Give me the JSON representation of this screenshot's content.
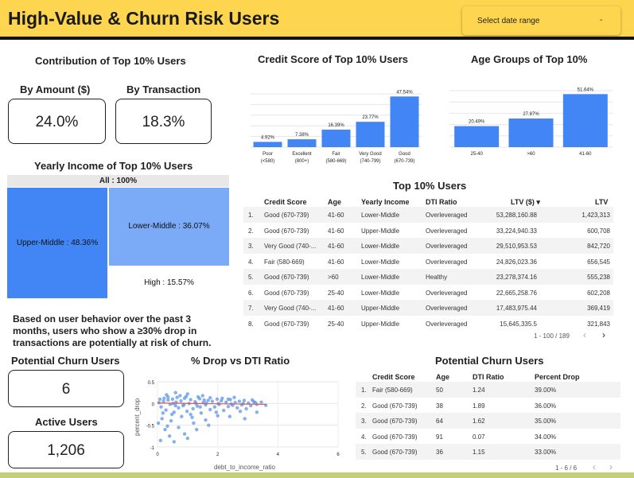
{
  "header": {
    "title": "High-Value & Churn Risk Users",
    "date_range_label": "Select date range",
    "caret": "-"
  },
  "contribution": {
    "title": "Contribution of Top 10% Users",
    "by_amount_label": "By Amount ($)",
    "by_amount_value": "24.0%",
    "by_transaction_label": "By Transaction",
    "by_transaction_value": "18.3%"
  },
  "churn_note": {
    "line1": "Based on user behavior over the past 3",
    "line2": "months, users who show a ≥30% drop in",
    "line3": "transactions are potentially at risk of churn."
  },
  "kpis": {
    "potential_label": "Potential Churn Users",
    "potential_value": "6",
    "active_label": "Active Users",
    "active_value": "1,206"
  },
  "top_users": {
    "title": "Top 10% Users",
    "columns": [
      "Credit Score",
      "Age",
      "Yearly Income",
      "DTI Ratio",
      "LTV ($) ▾",
      "LTV"
    ],
    "rows": [
      [
        "1.",
        "Good (670-739)",
        "41-60",
        "Lower-Middle",
        "Overleveraged",
        "53,288,160.88",
        "1,423,313"
      ],
      [
        "2.",
        "Good (670-739)",
        "41-60",
        "Upper-Middle",
        "Overleveraged",
        "33,224,940.33",
        "600,708"
      ],
      [
        "3.",
        "Very Good (740-...",
        "41-60",
        "Lower-Middle",
        "Overleveraged",
        "29,510,953.53",
        "842,720"
      ],
      [
        "4.",
        "Fair (580-669)",
        "41-60",
        "Lower-Middle",
        "Overleveraged",
        "24,826,023.36",
        "656,545"
      ],
      [
        "5.",
        "Good (670-739)",
        ">60",
        "Lower-Middle",
        "Healthy",
        "23,278,374.16",
        "555,238"
      ],
      [
        "6.",
        "Good (670-739)",
        "25-40",
        "Lower-Middle",
        "Overleveraged",
        "22,665,258.76",
        "602,208"
      ],
      [
        "7.",
        "Very Good (740-...",
        "41-60",
        "Upper-Middle",
        "Overleveraged",
        "17,483,975.44",
        "369,419"
      ],
      [
        "8.",
        "Good (670-739)",
        "25-40",
        "Upper-Middle",
        "Overleveraged",
        "15,645,335.5",
        "321,843"
      ]
    ],
    "pagination": "1 - 100 / 189"
  },
  "churn_table": {
    "title": "Potential Churn Users",
    "columns": [
      "Credit Score",
      "Age",
      "DTI Ratio",
      "Percent Drop"
    ],
    "rows": [
      [
        "1.",
        "Fair (580-669)",
        "50",
        "1.24",
        "39.00%"
      ],
      [
        "2.",
        "Good (670-739)",
        "38",
        "1.89",
        "36.00%"
      ],
      [
        "3.",
        "Good (670-739)",
        "64",
        "1.62",
        "35.00%"
      ],
      [
        "4.",
        "Good (670-739)",
        "91",
        "0.07",
        "34.00%"
      ],
      [
        "5.",
        "Good (670-739)",
        "36",
        "1.15",
        "33.00%"
      ]
    ],
    "pagination": "1 - 6 / 6"
  },
  "colors": {
    "header": "#fdd54f",
    "bar": "#4285f4",
    "treemap_dark": "#4285f4",
    "treemap_light": "#7baaf7",
    "scatter": "#5b95e6",
    "trend": "#e8594b"
  },
  "chart_data": [
    {
      "type": "bar",
      "title": "Credit Score of Top 10% Users",
      "categories": [
        "Poor\n(<580)",
        "Excellent\n(800+)",
        "Fair\n(580-669)",
        "Very Good\n(740-799)",
        "Good\n(670-739)"
      ],
      "values": [
        4.92,
        7.38,
        16.39,
        23.77,
        47.54
      ],
      "data_labels": [
        "4.92%",
        "7.38%",
        "16.39%",
        "23.77%",
        "47.54%"
      ],
      "ylim": [
        0,
        50
      ],
      "grid": true
    },
    {
      "type": "bar",
      "title": "Age Groups of Top 10%",
      "categories": [
        "25-40",
        ">60",
        "41-60"
      ],
      "values": [
        20.49,
        27.87,
        51.64
      ],
      "data_labels": [
        "20.49%",
        "27.87%",
        "51.64%"
      ],
      "ylim": [
        0,
        55
      ],
      "grid": true
    },
    {
      "type": "treemap",
      "title": "Yearly Income of Top 10% Users",
      "root_label": "All : 100%",
      "items": [
        {
          "label": "Upper-Middle : 48.36%",
          "value": 48.36
        },
        {
          "label": "Lower-Middle : 36.07%",
          "value": 36.07
        },
        {
          "label": "High : 15.57%",
          "value": 15.57
        }
      ]
    },
    {
      "type": "scatter",
      "title": "% Drop vs DTI Ratio",
      "xlabel": "debt_to_income_ratio",
      "ylabel": "percent_drop",
      "xlim": [
        0,
        6
      ],
      "ylim": [
        -1,
        0.5
      ],
      "xticks": [
        "0",
        "2",
        "4",
        "6"
      ],
      "yticks": [
        "0.5",
        "0",
        "-0.5",
        "-1"
      ],
      "trendline": true,
      "series": [
        {
          "points": [
            [
              0.05,
              0.02
            ],
            [
              0.12,
              -0.08
            ],
            [
              0.2,
              0.05
            ],
            [
              0.28,
              -0.15
            ],
            [
              0.35,
              0.08
            ],
            [
              0.42,
              -0.02
            ],
            [
              0.5,
              0.1
            ],
            [
              0.55,
              -0.2
            ],
            [
              0.62,
              0.03
            ],
            [
              0.7,
              -0.1
            ],
            [
              0.78,
              0.06
            ],
            [
              0.85,
              -0.05
            ],
            [
              0.9,
              0.12
            ],
            [
              0.98,
              -0.18
            ],
            [
              1.05,
              0.0
            ],
            [
              1.1,
              0.09
            ],
            [
              1.18,
              -0.12
            ],
            [
              1.25,
              0.04
            ],
            [
              1.32,
              -0.06
            ],
            [
              1.4,
              0.11
            ],
            [
              1.45,
              -0.22
            ],
            [
              1.52,
              0.02
            ],
            [
              1.6,
              -0.03
            ],
            [
              1.68,
              0.07
            ],
            [
              1.75,
              -0.14
            ],
            [
              1.82,
              0.05
            ],
            [
              1.9,
              -0.08
            ],
            [
              1.98,
              0.1
            ],
            [
              2.05,
              -0.02
            ],
            [
              2.12,
              0.06
            ],
            [
              2.2,
              -0.16
            ],
            [
              2.28,
              0.03
            ],
            [
              2.35,
              -0.07
            ],
            [
              2.42,
              0.09
            ],
            [
              2.5,
              -0.04
            ],
            [
              2.58,
              0.02
            ],
            [
              2.65,
              -0.1
            ],
            [
              2.72,
              0.05
            ],
            [
              2.8,
              -0.03
            ],
            [
              2.88,
              0.07
            ],
            [
              2.95,
              -0.12
            ],
            [
              3.02,
              0.01
            ],
            [
              3.1,
              -0.05
            ],
            [
              3.2,
              0.04
            ],
            [
              3.3,
              -0.02
            ],
            [
              3.45,
              0.03
            ],
            [
              3.6,
              -0.04
            ],
            [
              0.3,
              0.2
            ],
            [
              0.6,
              0.25
            ],
            [
              1.0,
              0.22
            ],
            [
              1.5,
              0.18
            ],
            [
              0.15,
              -0.35
            ],
            [
              0.45,
              -0.4
            ],
            [
              0.8,
              -0.3
            ],
            [
              1.2,
              -0.45
            ],
            [
              1.6,
              -0.38
            ],
            [
              2.0,
              -0.28
            ],
            [
              0.25,
              -0.6
            ],
            [
              0.7,
              -0.55
            ],
            [
              1.1,
              -0.25
            ],
            [
              0.4,
              -0.75
            ],
            [
              0.9,
              -0.7
            ],
            [
              1.3,
              -0.6
            ],
            [
              1.7,
              -0.5
            ],
            [
              2.4,
              -0.3
            ],
            [
              2.9,
              -0.35
            ],
            [
              0.1,
              -0.85
            ],
            [
              0.55,
              -0.88
            ],
            [
              1.0,
              -0.8
            ],
            [
              3.3,
              -0.2
            ],
            [
              0.35,
              0.15
            ],
            [
              0.65,
              0.14
            ],
            [
              0.95,
              0.16
            ],
            [
              1.35,
              0.15
            ],
            [
              1.75,
              0.13
            ],
            [
              2.15,
              0.12
            ],
            [
              2.55,
              0.14
            ],
            [
              0.08,
              0.1
            ],
            [
              0.18,
              -0.22
            ],
            [
              0.48,
              -0.25
            ],
            [
              0.75,
              0.18
            ],
            [
              1.15,
              -0.32
            ],
            [
              1.55,
              0.08
            ],
            [
              1.95,
              -0.2
            ],
            [
              2.35,
              0.1
            ],
            [
              2.75,
              -0.18
            ],
            [
              3.15,
              0.08
            ],
            [
              0.22,
              0.12
            ],
            [
              0.52,
              0.0
            ],
            [
              0.88,
              -0.02
            ],
            [
              1.28,
              0.0
            ],
            [
              1.62,
              0.01
            ],
            [
              2.02,
              0.0
            ],
            [
              2.45,
              -0.01
            ],
            [
              2.85,
              0.0
            ],
            [
              3.25,
              0.02
            ],
            [
              0.03,
              -0.45
            ],
            [
              0.33,
              -0.52
            ],
            [
              0.6,
              -0.05
            ],
            [
              1.42,
              -0.08
            ]
          ]
        }
      ]
    }
  ]
}
